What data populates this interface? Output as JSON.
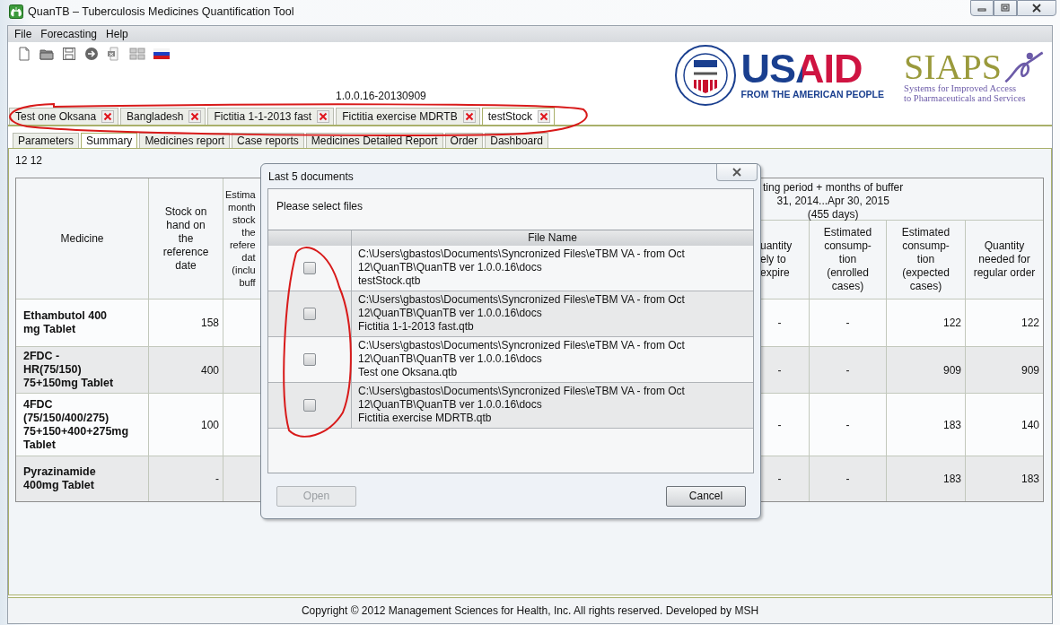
{
  "window": {
    "title": "QuanTB – Tuberculosis Medicines Quantification Tool"
  },
  "menu": [
    "File",
    "Forecasting",
    "Help"
  ],
  "version": "1.0.0.16-20130909",
  "logos": {
    "usaid": "USAID",
    "usaid_tagline": "FROM THE AMERICAN PEOPLE",
    "siaps": "SIAPS",
    "siaps_tagline": [
      "Systems for Improved Access",
      "to Pharmaceuticals and Services"
    ]
  },
  "document_tabs": [
    {
      "label": "Test one Oksana",
      "selected": false
    },
    {
      "label": "Bangladesh",
      "selected": false
    },
    {
      "label": "Fictitia 1-1-2013 fast",
      "selected": false
    },
    {
      "label": "Fictitia exercise MDRTB",
      "selected": false
    },
    {
      "label": "testStock",
      "selected": true
    }
  ],
  "report_tabs": [
    {
      "label": "Parameters",
      "selected": false
    },
    {
      "label": "Summary",
      "selected": true
    },
    {
      "label": "Medicines report",
      "selected": false
    },
    {
      "label": "Case reports",
      "selected": false
    },
    {
      "label": "Medicines Detailed Report",
      "selected": false
    },
    {
      "label": "Order",
      "selected": false
    },
    {
      "label": "Dashboard",
      "selected": false
    }
  ],
  "summary": {
    "heading": "12 12",
    "table": {
      "columns": [
        {
          "lines": [
            "Medicine"
          ]
        },
        {
          "lines": [
            "Stock on",
            "hand on",
            "the",
            "reference",
            "date"
          ]
        },
        {
          "lines": [
            "Estima",
            "month",
            "stock",
            "the",
            "refere",
            "dat",
            "(inclu",
            "buff"
          ]
        },
        {
          "lines": [
            "uantity",
            "ely to",
            "expire"
          ]
        },
        {
          "lines": [
            "Estimated",
            "consump-",
            "tion",
            "(enrolled",
            "cases)"
          ]
        },
        {
          "lines": [
            "Estimated",
            "consump-",
            "tion",
            "(expected",
            "cases)"
          ]
        },
        {
          "lines": [
            "Quantity",
            "needed for",
            "regular order"
          ]
        }
      ],
      "group_header": [
        "ting period + months of buffer",
        "31, 2014...Apr 30, 2015",
        "(455 days)"
      ],
      "rows": [
        {
          "medicine": [
            "Ethambutol 400",
            "mg Tablet"
          ],
          "values": [
            "158",
            "-",
            "-",
            "122",
            "122"
          ]
        },
        {
          "medicine": [
            "2FDC -",
            "HR(75/150)",
            "75+150mg Tablet"
          ],
          "values": [
            "400",
            "-",
            "-",
            "909",
            "909"
          ]
        },
        {
          "medicine": [
            "4FDC",
            "(75/150/400/275)",
            "75+150+400+275mg",
            "Tablet"
          ],
          "values": [
            "100",
            "-",
            "-",
            "183",
            "140"
          ]
        },
        {
          "medicine": [
            "Pyrazinamide",
            "400mg Tablet"
          ],
          "values": [
            "-",
            "-",
            "-",
            "183",
            "183"
          ]
        }
      ]
    }
  },
  "dialog": {
    "title": "Last 5 documents",
    "prompt": "Please select files",
    "column": "File Name",
    "files": [
      {
        "lines": [
          "C:\\Users\\gbastos\\Documents\\Syncronized Files\\eTBM VA - from Oct",
          "12\\QuanTB\\QuanTB ver 1.0.0.16\\docs",
          "testStock.qtb"
        ],
        "checked": false
      },
      {
        "lines": [
          "C:\\Users\\gbastos\\Documents\\Syncronized Files\\eTBM VA - from Oct",
          "12\\QuanTB\\QuanTB ver 1.0.0.16\\docs",
          "Fictitia 1-1-2013 fast.qtb"
        ],
        "checked": false
      },
      {
        "lines": [
          "C:\\Users\\gbastos\\Documents\\Syncronized Files\\eTBM VA - from Oct",
          "12\\QuanTB\\QuanTB ver 1.0.0.16\\docs",
          "Test one Oksana.qtb"
        ],
        "checked": false
      },
      {
        "lines": [
          "C:\\Users\\gbastos\\Documents\\Syncronized Files\\eTBM VA - from Oct",
          "12\\QuanTB\\QuanTB ver 1.0.0.16\\docs",
          "Fictitia exercise MDRTB.qtb"
        ],
        "checked": false
      }
    ],
    "buttons": [
      {
        "label": "Open",
        "disabled": true
      },
      {
        "label": "Cancel",
        "disabled": false
      }
    ]
  },
  "footer": "Copyright © 2012 Management Sciences for Health, Inc. All rights reserved. Developed by MSH"
}
